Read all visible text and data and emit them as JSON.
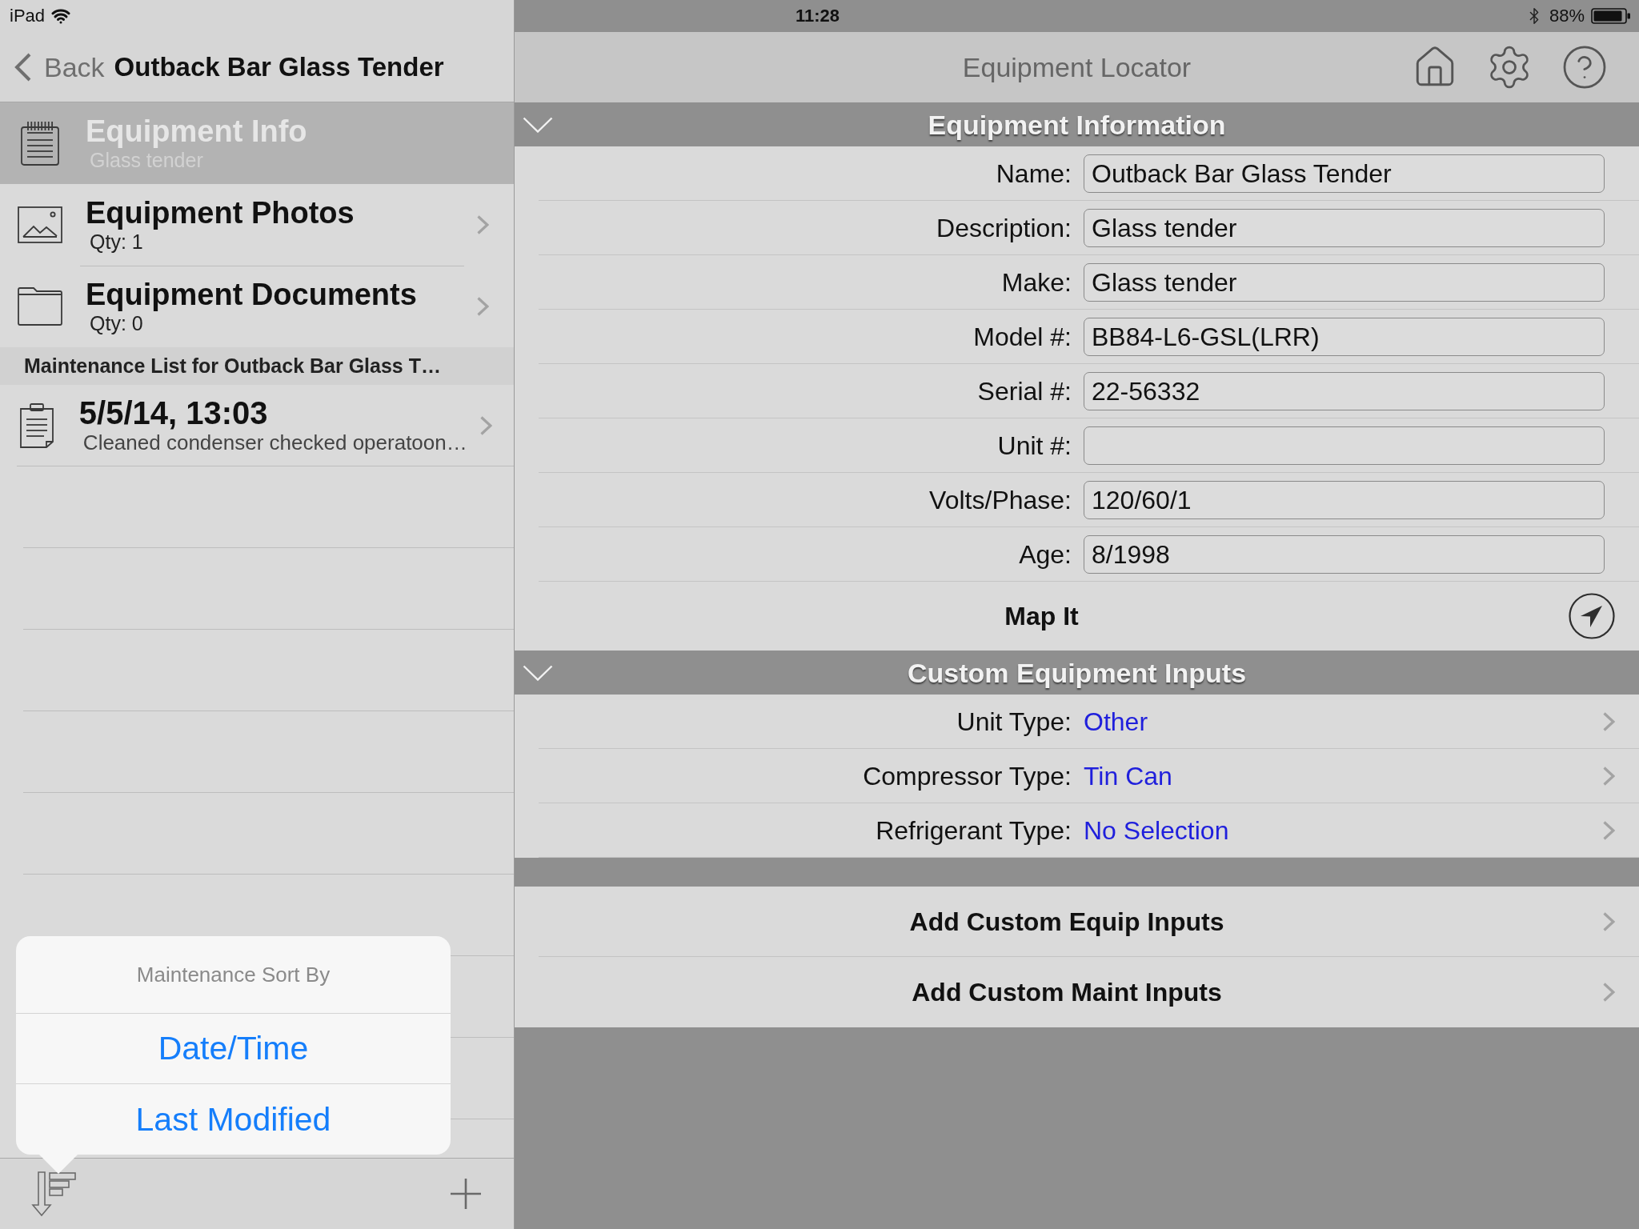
{
  "status_bar": {
    "device": "iPad",
    "time": "11:28",
    "battery": "88%"
  },
  "sidebar": {
    "back": "Back",
    "title": "Outback Bar Glass Tender",
    "items": [
      {
        "title": "Equipment Info",
        "subtitle": "Glass tender",
        "selected": true
      },
      {
        "title": "Equipment Photos",
        "subtitle": "Qty: 1",
        "selected": false
      },
      {
        "title": "Equipment Documents",
        "subtitle": "Qty: 0",
        "selected": false
      }
    ],
    "maintenance_header": "Maintenance List for Outback Bar Glass T…",
    "maintenance": [
      {
        "date": "5/5/14, 13:03",
        "note": "Cleaned condenser checked operatoon…"
      }
    ],
    "sort_menu": {
      "title": "Maintenance Sort By",
      "options": [
        "Date/Time",
        "Last Modified"
      ]
    }
  },
  "main": {
    "title": "Equipment Locator",
    "equipment_information": {
      "title": "Equipment Information",
      "expanded": true,
      "fields": [
        {
          "label": "Name:",
          "value": "Outback Bar Glass Tender"
        },
        {
          "label": "Description:",
          "value": "Glass tender"
        },
        {
          "label": "Make:",
          "value": "Glass tender"
        },
        {
          "label": "Model #:",
          "value": "BB84-L6-GSL(LRR)"
        },
        {
          "label": "Serial #:",
          "value": "22-56332"
        },
        {
          "label": "Unit #:"
        },
        {
          "label": "Volts/Phase:",
          "value": "120/60/1"
        },
        {
          "label": "Age:",
          "value": "8/1998"
        }
      ],
      "map_it": "Map It"
    },
    "custom_equipment_inputs": {
      "title": "Custom Equipment Inputs",
      "expanded": true,
      "rows": [
        {
          "label": "Unit Type:",
          "value": "Other"
        },
        {
          "label": "Compressor Type:",
          "value": "Tin Can"
        },
        {
          "label": "Refrigerant Type:",
          "value": "No Selection"
        }
      ]
    },
    "actions": [
      "Add Custom Equip Inputs",
      "Add Custom Maint Inputs"
    ]
  }
}
